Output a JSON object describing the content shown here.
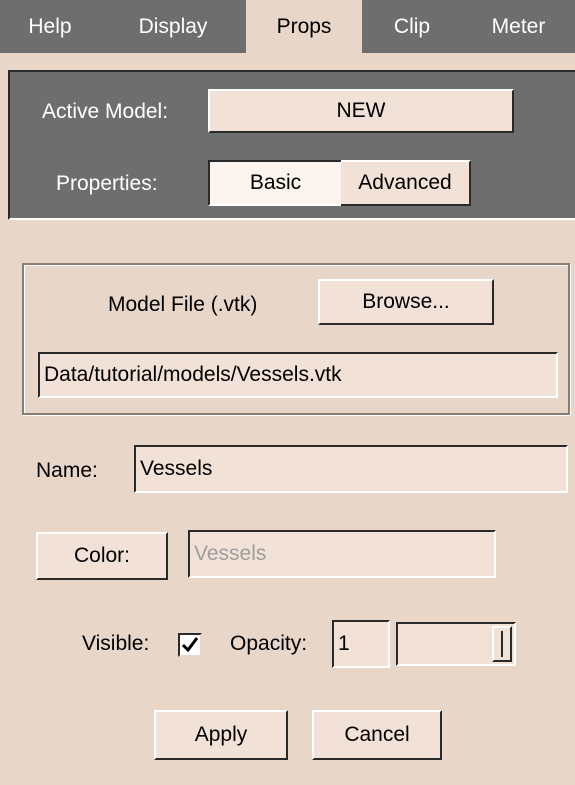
{
  "tabs": [
    {
      "label": "Help",
      "active": false
    },
    {
      "label": "Display",
      "active": false
    },
    {
      "label": "Props",
      "active": true
    },
    {
      "label": "Clip",
      "active": false
    },
    {
      "label": "Meter",
      "active": false
    }
  ],
  "model_panel": {
    "active_model_label": "Active Model:",
    "active_model_value": "NEW",
    "properties_label": "Properties:",
    "properties_options": [
      "Basic",
      "Advanced"
    ],
    "properties_selected": "Basic"
  },
  "model_file": {
    "label": "Model File (.vtk)",
    "browse_label": "Browse...",
    "path": "Data/tutorial/models/Vessels.vtk"
  },
  "name": {
    "label": "Name:",
    "value": "Vessels"
  },
  "color": {
    "button_label": "Color:",
    "value": "Vessels"
  },
  "visibility": {
    "visible_label": "Visible:",
    "visible_checked": true,
    "opacity_label": "Opacity:",
    "opacity_value": "1",
    "opacity_fraction": 1.0
  },
  "actions": {
    "apply_label": "Apply",
    "cancel_label": "Cancel"
  },
  "colors": {
    "panel_bg": "#e8d6c8",
    "tab_bar": "#6e6e6e",
    "disabled_text": "#9e9e9e"
  }
}
